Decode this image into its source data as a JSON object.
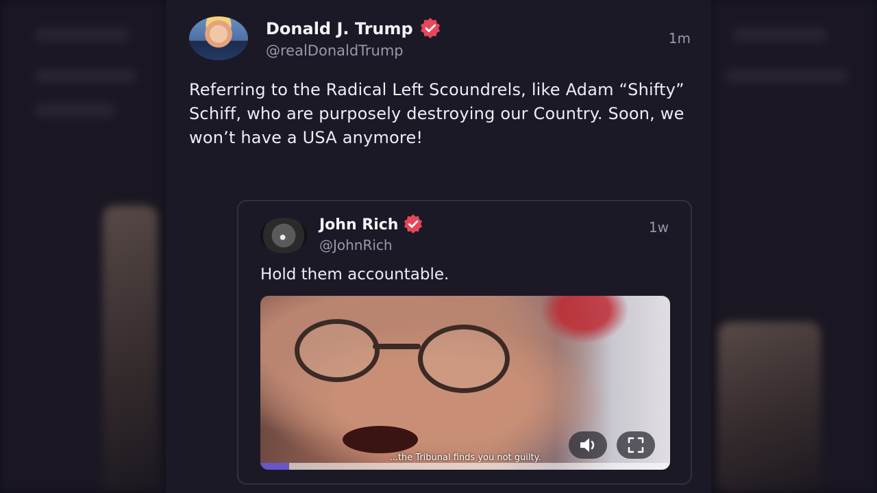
{
  "post": {
    "author_name": "Donald J. Trump",
    "author_handle": "@realDonaldTrump",
    "timestamp": "1m",
    "text": "Referring to the Radical Left Scoundrels, like Adam “Shifty” Schiff, who are purposely destroying our Country. Soon, we won’t have a USA anymore!"
  },
  "quoted_post": {
    "author_name": "John Rich",
    "author_handle": "@JohnRich",
    "timestamp": "1w",
    "text": "Hold them accountable.",
    "video": {
      "caption": "...the Tribunal finds you not guilty.",
      "progress": 0.07
    }
  },
  "colors": {
    "verified_badge": "#e6475a",
    "background": "#1c1927",
    "progress": "#6a56c9"
  },
  "icons": [
    "verified-badge-icon",
    "volume-icon",
    "fullscreen-icon"
  ]
}
